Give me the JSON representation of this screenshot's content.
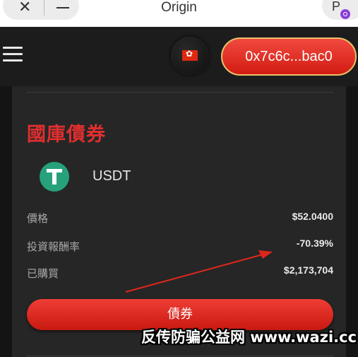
{
  "browser": {
    "title": "Origin",
    "profile_initial": "P",
    "close_icon": "close-icon",
    "minimize_icon": "minimize-icon"
  },
  "header": {
    "menu_icon": "hamburger-menu-icon",
    "region_flag": "hong-kong-flag-icon",
    "wallet_address": "0x7c6c...bac0"
  },
  "card": {
    "title": "國庫債券",
    "token": {
      "icon": "tether-usdt-icon",
      "name": "USDT"
    },
    "rows": [
      {
        "label": "價格",
        "value": "$52.0400"
      },
      {
        "label": "投資報酬率",
        "value": "-70.39%"
      },
      {
        "label": "已購買",
        "value": "$2,173,704"
      }
    ],
    "action_label": "債券"
  },
  "watermark": "反传防骗公益网 www.wazi.cc",
  "colors": {
    "accent_red": "#e02f2f",
    "button_gold_border": "#e8c26a",
    "usdt_green": "#26a17b",
    "background": "#161616",
    "card": "#262626"
  }
}
